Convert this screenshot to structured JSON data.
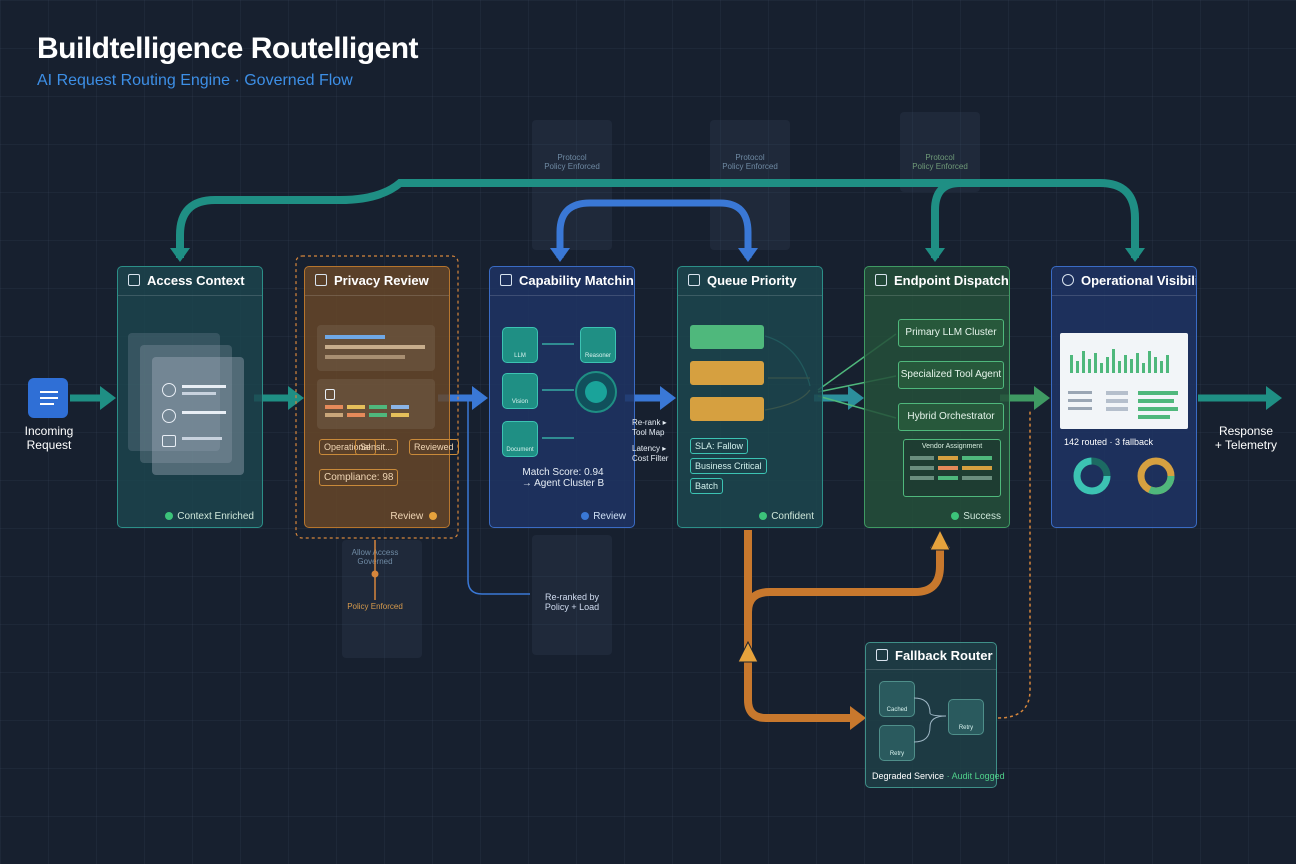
{
  "header": {
    "title": "Buildtelligence Routelligent",
    "subtitle": "AI Request Routing Engine · Governed Flow"
  },
  "io": {
    "input_label": [
      "Incoming",
      "Request"
    ],
    "output_label": [
      "Response",
      "+ Telemetry"
    ]
  },
  "stages": {
    "access": {
      "title": "Access Context",
      "footer": "Context Enriched"
    },
    "privacy": {
      "title": "Privacy Review",
      "chips": [
        "Operational",
        "Sensit...",
        "Reviewed"
      ],
      "compliance": "Compliance: 98",
      "footer": "Review"
    },
    "capability": {
      "title": "Capability Matching",
      "nodes": [
        "LLM",
        "Vision",
        "Document",
        "Reasoner"
      ],
      "match_score": "Match Score: 0.94",
      "match_target": "→ Agent Cluster B",
      "footer": "Review"
    },
    "queue": {
      "title": "Queue Priority",
      "side_labels": [
        "Re-rank ▸",
        "Tool Map",
        "Latency ▸",
        "Cost Filter"
      ],
      "chips": [
        "SLA: Fallow",
        "Business Critical",
        "Batch"
      ],
      "footer": "Confident"
    },
    "endpoint": {
      "title": "Endpoint Dispatch",
      "destinations": [
        "Primary LLM Cluster",
        "Specialized Tool Agent",
        "Hybrid Orchestrator"
      ],
      "table_title": "Vendor Assignment",
      "footer": "Success"
    },
    "ops": {
      "title": "Operational Visibility",
      "stats": "142 routed · 3 fallback"
    }
  },
  "governance": {
    "top_notes": [
      [
        "Protocol",
        "Policy Enforced"
      ],
      [
        "Protocol",
        "Policy Enforced"
      ],
      [
        "Protocol",
        "Policy Enforced"
      ]
    ],
    "privacy_note": [
      "Policy Enforced"
    ],
    "privacy_bottom_lines": [
      "Allow Access",
      "Governed"
    ],
    "rerank_note": [
      "Re-ranked by",
      "Policy + Load"
    ]
  },
  "fallback": {
    "title": "Fallback Router",
    "nodes": [
      "Cached",
      "Retry",
      "Retry"
    ],
    "footer_left": "Degraded Service",
    "footer_right": "· Audit Logged"
  },
  "colors": {
    "teal": "#1f8f84",
    "blue": "#3a78d6",
    "orange": "#c8782d",
    "green": "#4fb87c",
    "yellow": "#d6a040"
  }
}
